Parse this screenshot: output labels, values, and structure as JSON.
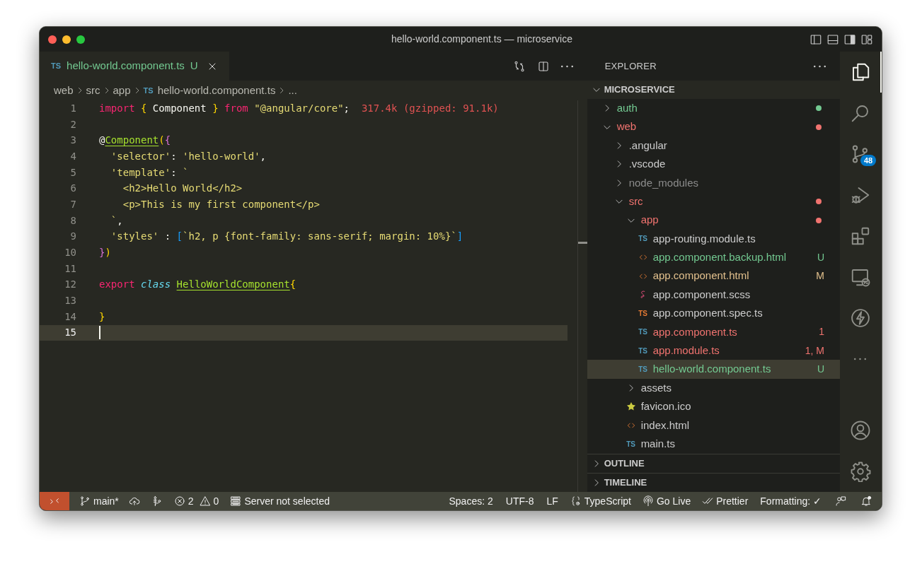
{
  "window": {
    "title": "hello-world.component.ts — microservice"
  },
  "tabs": [
    {
      "icon_label": "TS",
      "label": "hello-world.component.ts",
      "status": "U",
      "selected": true
    }
  ],
  "breadcrumbs": [
    {
      "kind": "folder",
      "label": "web"
    },
    {
      "kind": "folder",
      "label": "src"
    },
    {
      "kind": "folder",
      "label": "app"
    },
    {
      "kind": "file",
      "icon_label": "TS",
      "label": "hello-world.component.ts"
    },
    {
      "kind": "more",
      "label": "..."
    }
  ],
  "code_lines": [
    {
      "number": "1",
      "current": false,
      "tokens": [
        {
          "kind": "keyword",
          "text": "import"
        },
        {
          "kind": "bracket1",
          "text": " {"
        },
        {
          "kind": "plain",
          "text": " Component "
        },
        {
          "kind": "bracket1",
          "text": "}"
        },
        {
          "kind": "keyword",
          "text": " from"
        },
        {
          "kind": "string",
          "text": " \"@angular/core\""
        },
        {
          "kind": "plain",
          "text": ";"
        },
        {
          "kind": "hint",
          "text": "  317.4k (gzipped: 91.1k)"
        }
      ]
    },
    {
      "number": "2",
      "current": false
    },
    {
      "number": "3",
      "current": false,
      "tokens": [
        {
          "kind": "plain",
          "text": "@"
        },
        {
          "kind": "function",
          "text": "Component"
        },
        {
          "kind": "bracket1",
          "text": "("
        },
        {
          "kind": "bracket2",
          "text": "{"
        }
      ]
    },
    {
      "number": "4",
      "current": false,
      "tokens": [
        {
          "kind": "string",
          "text": "  'selector'"
        },
        {
          "kind": "plain",
          "text": ": "
        },
        {
          "kind": "string",
          "text": "'hello-world'"
        },
        {
          "kind": "plain",
          "text": ","
        }
      ]
    },
    {
      "number": "5",
      "current": false,
      "tokens": [
        {
          "kind": "string",
          "text": "  'template'"
        },
        {
          "kind": "plain",
          "text": ": "
        },
        {
          "kind": "string",
          "text": "`"
        }
      ]
    },
    {
      "number": "6",
      "current": false,
      "tokens": [
        {
          "kind": "string",
          "text": "    <h2>Hello World</h2>"
        }
      ]
    },
    {
      "number": "7",
      "current": false,
      "tokens": [
        {
          "kind": "string",
          "text": "    <p>This is my first component</p>"
        }
      ]
    },
    {
      "number": "8",
      "current": false,
      "tokens": [
        {
          "kind": "string",
          "text": "  `"
        },
        {
          "kind": "plain",
          "text": ","
        }
      ]
    },
    {
      "number": "9",
      "current": false,
      "tokens": [
        {
          "kind": "string",
          "text": "  'styles'"
        },
        {
          "kind": "plain",
          "text": " : "
        },
        {
          "kind": "bracket3",
          "text": "["
        },
        {
          "kind": "string",
          "text": "`h2, p {font-family: sans-serif; margin: 10%}`"
        },
        {
          "kind": "bracket3",
          "text": "]"
        }
      ]
    },
    {
      "number": "10",
      "current": false,
      "tokens": [
        {
          "kind": "bracket2",
          "text": "}"
        },
        {
          "kind": "bracket1",
          "text": ")"
        }
      ]
    },
    {
      "number": "11",
      "current": false
    },
    {
      "number": "12",
      "current": false,
      "tokens": [
        {
          "kind": "keyword",
          "text": "export"
        },
        {
          "kind": "storage",
          "text": " class "
        },
        {
          "kind": "function",
          "text": "HelloWorldComponent"
        },
        {
          "kind": "bracket1",
          "text": "{"
        }
      ]
    },
    {
      "number": "13",
      "current": false
    },
    {
      "number": "14",
      "current": false,
      "tokens": [
        {
          "kind": "bracket1",
          "text": "}"
        }
      ]
    },
    {
      "number": "15",
      "current": true
    }
  ],
  "explorer": {
    "title": "EXPLORER",
    "root": {
      "label": "MICROSERVICE",
      "expanded": true
    },
    "tree": [
      {
        "kind": "folder",
        "label": "auth",
        "expanded": false,
        "color": "#73c991",
        "dot": true,
        "selected": false
      },
      {
        "kind": "folder",
        "label": "web",
        "expanded": true,
        "color": "#f0736f",
        "dot": true,
        "selected": false,
        "children": [
          {
            "kind": "folder",
            "label": ".angular",
            "expanded": false,
            "color": "#cccccc",
            "dot": false,
            "selected": false
          },
          {
            "kind": "folder",
            "label": ".vscode",
            "expanded": false,
            "color": "#cccccc",
            "dot": false,
            "selected": false
          },
          {
            "kind": "folder",
            "label": "node_modules",
            "expanded": false,
            "color": "#8c8c8c",
            "dot": false,
            "selected": false
          },
          {
            "kind": "folder",
            "label": "src",
            "expanded": true,
            "color": "#f0736f",
            "dot": true,
            "selected": false,
            "children": [
              {
                "kind": "folder",
                "label": "app",
                "expanded": true,
                "color": "#f0736f",
                "dot": true,
                "selected": false,
                "children": [
                  {
                    "kind": "ts",
                    "icon_label": "TS",
                    "label": "app-routing.module.ts",
                    "color": "#cccccc",
                    "selected": false
                  },
                  {
                    "kind": "html",
                    "label": "app.component.backup.html",
                    "color": "#73c991",
                    "status": "U",
                    "selected": false
                  },
                  {
                    "kind": "html",
                    "label": "app.component.html",
                    "color": "#e2c08d",
                    "status": "M",
                    "selected": false
                  },
                  {
                    "kind": "scss",
                    "label": "app.component.scss",
                    "color": "#cccccc",
                    "selected": false
                  },
                  {
                    "kind": "spec",
                    "icon_label": "TS",
                    "label": "app.component.spec.ts",
                    "color": "#cccccc",
                    "selected": false
                  },
                  {
                    "kind": "ts",
                    "icon_label": "TS",
                    "label": "app.component.ts",
                    "color": "#f0736f",
                    "status": "1",
                    "selected": false
                  },
                  {
                    "kind": "ts",
                    "icon_label": "TS",
                    "label": "app.module.ts",
                    "color": "#f0736f",
                    "status": "1, M",
                    "selected": false
                  },
                  {
                    "kind": "ts",
                    "icon_label": "TS",
                    "label": "hello-world.component.ts",
                    "color": "#73c991",
                    "status": "U",
                    "selected": true
                  }
                ]
              },
              {
                "kind": "folder",
                "label": "assets",
                "expanded": false,
                "color": "#cccccc",
                "dot": false,
                "selected": false
              },
              {
                "kind": "image",
                "label": "favicon.ico",
                "color": "#cccccc",
                "selected": false
              },
              {
                "kind": "html",
                "label": "index.html",
                "color": "#cccccc",
                "selected": false
              },
              {
                "kind": "ts",
                "icon_label": "TS",
                "label": "main.ts",
                "color": "#cccccc",
                "selected": false
              }
            ]
          }
        ]
      }
    ],
    "sections": [
      {
        "label": "OUTLINE",
        "expanded": false
      },
      {
        "label": "TIMELINE",
        "expanded": false
      }
    ]
  },
  "activity_bar": {
    "top": [
      {
        "kind": "explorer",
        "selected": true
      },
      {
        "kind": "search",
        "selected": false
      },
      {
        "kind": "source-control",
        "badge": "48",
        "selected": false
      },
      {
        "kind": "run",
        "selected": false
      },
      {
        "kind": "extensions",
        "selected": false
      },
      {
        "kind": "remote",
        "selected": false
      },
      {
        "kind": "lightning",
        "selected": false
      },
      {
        "kind": "more",
        "selected": false
      }
    ],
    "bottom": [
      {
        "kind": "account",
        "selected": false
      },
      {
        "kind": "settings",
        "selected": false
      }
    ]
  },
  "status_bar": {
    "left": [
      {
        "kind": "remote"
      },
      {
        "kind": "branch",
        "text": "main*"
      },
      {
        "kind": "publish"
      },
      {
        "kind": "graph"
      },
      {
        "kind": "problems",
        "errors": "2",
        "warnings": "0"
      },
      {
        "kind": "server",
        "text": "Server not selected"
      }
    ],
    "right": [
      {
        "kind": "text",
        "text": "Spaces: 2"
      },
      {
        "kind": "text",
        "text": "UTF-8"
      },
      {
        "kind": "text",
        "text": "LF"
      },
      {
        "kind": "language",
        "text": "TypeScript"
      },
      {
        "kind": "live",
        "text": "Go Live"
      },
      {
        "kind": "prettier",
        "text": "Prettier"
      },
      {
        "kind": "text",
        "text": "Formatting: ✓"
      },
      {
        "kind": "feedback"
      },
      {
        "kind": "bell"
      }
    ]
  }
}
